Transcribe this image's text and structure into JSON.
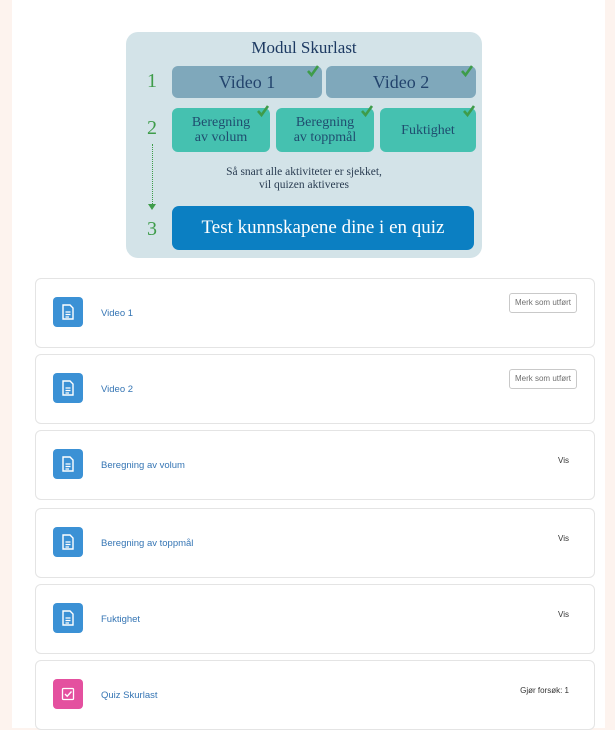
{
  "diagram": {
    "title": "Modul Skurlast",
    "steps": [
      "1",
      "2",
      "3"
    ],
    "videos": [
      "Video 1",
      "Video 2"
    ],
    "activities": [
      {
        "line1": "Beregning",
        "line2": "av volum"
      },
      {
        "line1": "Beregning",
        "line2": "av toppmål"
      },
      {
        "line1": "Fuktighet",
        "line2": ""
      }
    ],
    "hint_line1": "Så snart alle aktiviteter er sjekket,",
    "hint_line2": "vil quizen aktiveres",
    "quiz_button": "Test kunnskapene dine i en quiz",
    "colors": {
      "check": "#3e9c4a",
      "quiz_button": "#0b7fc2",
      "activity_tile": "#45c1b0",
      "video_tile": "#7fa8bb"
    }
  },
  "activities": [
    {
      "title": "Video 1",
      "icon": "page-icon",
      "action": "Merk som utført"
    },
    {
      "title": "Video 2",
      "icon": "page-icon",
      "action": "Merk som utført"
    },
    {
      "title": "Beregning av volum",
      "icon": "page-icon",
      "status": "Vis"
    },
    {
      "title": "Beregning av toppmål",
      "icon": "page-icon",
      "status": "Vis"
    },
    {
      "title": "Fuktighet",
      "icon": "page-icon",
      "status": "Vis"
    },
    {
      "title": "Quiz Skurlast",
      "icon": "quiz-icon",
      "status": "Gjør forsøk: 1"
    }
  ]
}
